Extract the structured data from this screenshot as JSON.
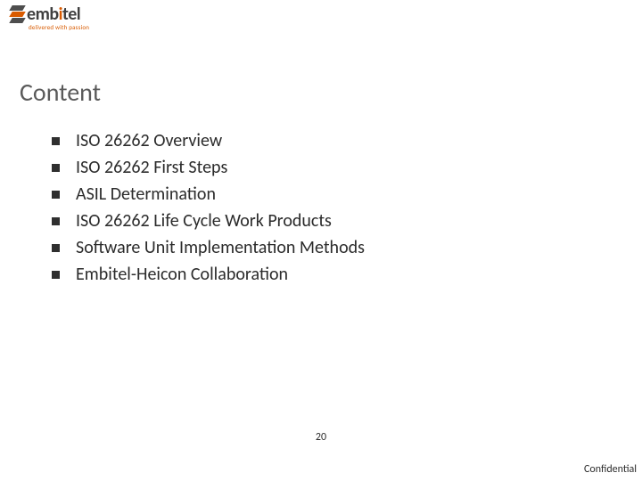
{
  "logo": {
    "name_pre": "emb",
    "name_mid": "i",
    "name_post": "tel",
    "tagline": "delivered with passion"
  },
  "title": "Content",
  "items": [
    "ISO 26262 Overview",
    "ISO 26262 First Steps",
    "ASIL Determination",
    "ISO 26262 Life Cycle Work Products",
    "Software Unit Implementation Methods",
    "Embitel-Heicon Collaboration"
  ],
  "page_number": "20",
  "footer": "Confidential"
}
